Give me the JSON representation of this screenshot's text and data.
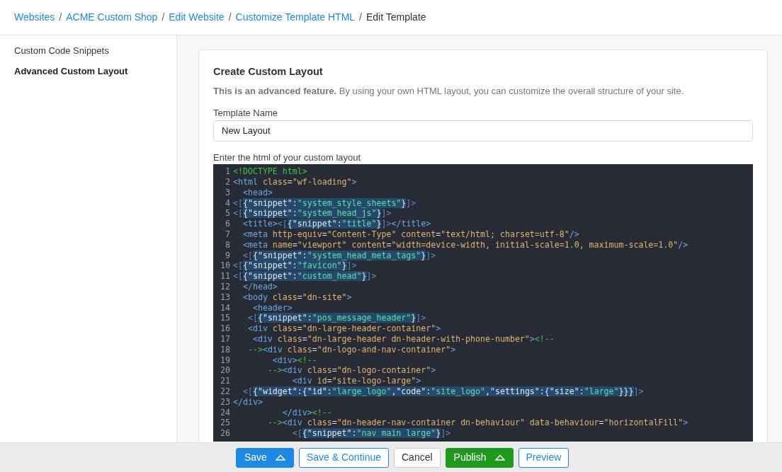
{
  "breadcrumbs": [
    {
      "label": "Websites",
      "link": true
    },
    {
      "separator": "/",
      "label": "ACME Custom Shop",
      "link": true
    },
    {
      "separator": "/",
      "label": "Edit Website",
      "link": true
    },
    {
      "separator": "/",
      "label": "Customize Template HTML",
      "link": true
    },
    {
      "separator": "/",
      "label": "Edit Template",
      "link": false
    }
  ],
  "sidebar": {
    "items": [
      {
        "label": "Custom Code Snippets",
        "selected": false
      },
      {
        "label": "Advanced Custom Layout",
        "selected": true
      }
    ]
  },
  "card": {
    "title": "Create Custom Layout",
    "intro": "**This is an advanced feature.** By using your own HTML layout, you can customize the overall structure of your site.",
    "template_name": {
      "label": "Template Name",
      "value": "New Layout"
    },
    "editor": {
      "label": "Enter the html of your custom layout",
      "lines": [
        {
          "number": "1",
          "text": "<!DOCTYPE html>"
        },
        {
          "number": "2",
          "text": "<html class=\"wf-loading\">"
        },
        {
          "number": "3",
          "text": "  <head>"
        },
        {
          "number": "4",
          "text": "<[{\"snippet\":\"system_style_sheets\"}]>"
        },
        {
          "number": "5",
          "text": "<[{\"snippet\":\"system_head_js\"}]>"
        },
        {
          "number": "6",
          "text": "  <title><[{\"snippet\":\"title\"}]></title>"
        },
        {
          "number": "7",
          "text": "  <meta http-equiv=\"Content-Type\" content=\"text/html; charset=utf-8\"/>"
        },
        {
          "number": "8",
          "text": "  <meta name=\"viewport\" content=\"width=device-width, initial-scale=1.0, maximum-scale=1.0\"/>"
        },
        {
          "number": "9",
          "text": "  <[{\"snippet\":\"system_head_meta_tags\"}]>"
        },
        {
          "number": "10",
          "text": "<[{\"snippet\":\"favicon\"}]>"
        },
        {
          "number": "11",
          "text": "<[{\"snippet\":\"custom_head\"}]>"
        },
        {
          "number": "12",
          "text": "  </head>"
        },
        {
          "number": "13",
          "text": "  <body class=\"dn-site\">"
        },
        {
          "number": "14",
          "text": "    <header>"
        },
        {
          "number": "15",
          "text": "   <[{\"snippet\":\"pos_message_header\"}]>"
        },
        {
          "number": "16",
          "text": "   <div class=\"dn-large-header-container\">"
        },
        {
          "number": "17",
          "text": "    <div class=\"dn-large-header dn-header-with-phone-number\"><!--"
        },
        {
          "number": "18",
          "text": "   --><div class=\"dn-logo-and-nav-container\">"
        },
        {
          "number": "19",
          "text": "        <div><!--"
        },
        {
          "number": "20",
          "text": "       --><div class=\"dn-logo-container\">"
        },
        {
          "number": "21",
          "text": "            <div id=\"site-logo-large\">"
        },
        {
          "number": "22",
          "text": "  <[{\"widget\":{\"id\":\"large_logo\",\"code\":\"site_logo\",\"settings\":{\"size\":\"large\"}}}]>"
        },
        {
          "number": "23",
          "text": "</div>"
        },
        {
          "number": "24",
          "text": "          </div><!--"
        },
        {
          "number": "25",
          "text": "       --><div class=\"dn-header-nav-container dn-behaviour\" data-behaviour=\"horizontalFill\">"
        },
        {
          "number": "26",
          "text": "            <[{\"snippet\":\"nav main large\"}]>"
        }
      ]
    }
  },
  "footer": {
    "buttons": [
      {
        "label": "Save",
        "kind": "primary",
        "menu": true
      },
      {
        "label": "Save & Continue",
        "kind": "outline",
        "menu": false
      },
      {
        "label": "Cancel",
        "kind": "plain",
        "menu": false
      },
      {
        "label": "Publish",
        "kind": "success",
        "menu": true
      },
      {
        "label": "Preview",
        "kind": "outline",
        "menu": false
      }
    ]
  }
}
